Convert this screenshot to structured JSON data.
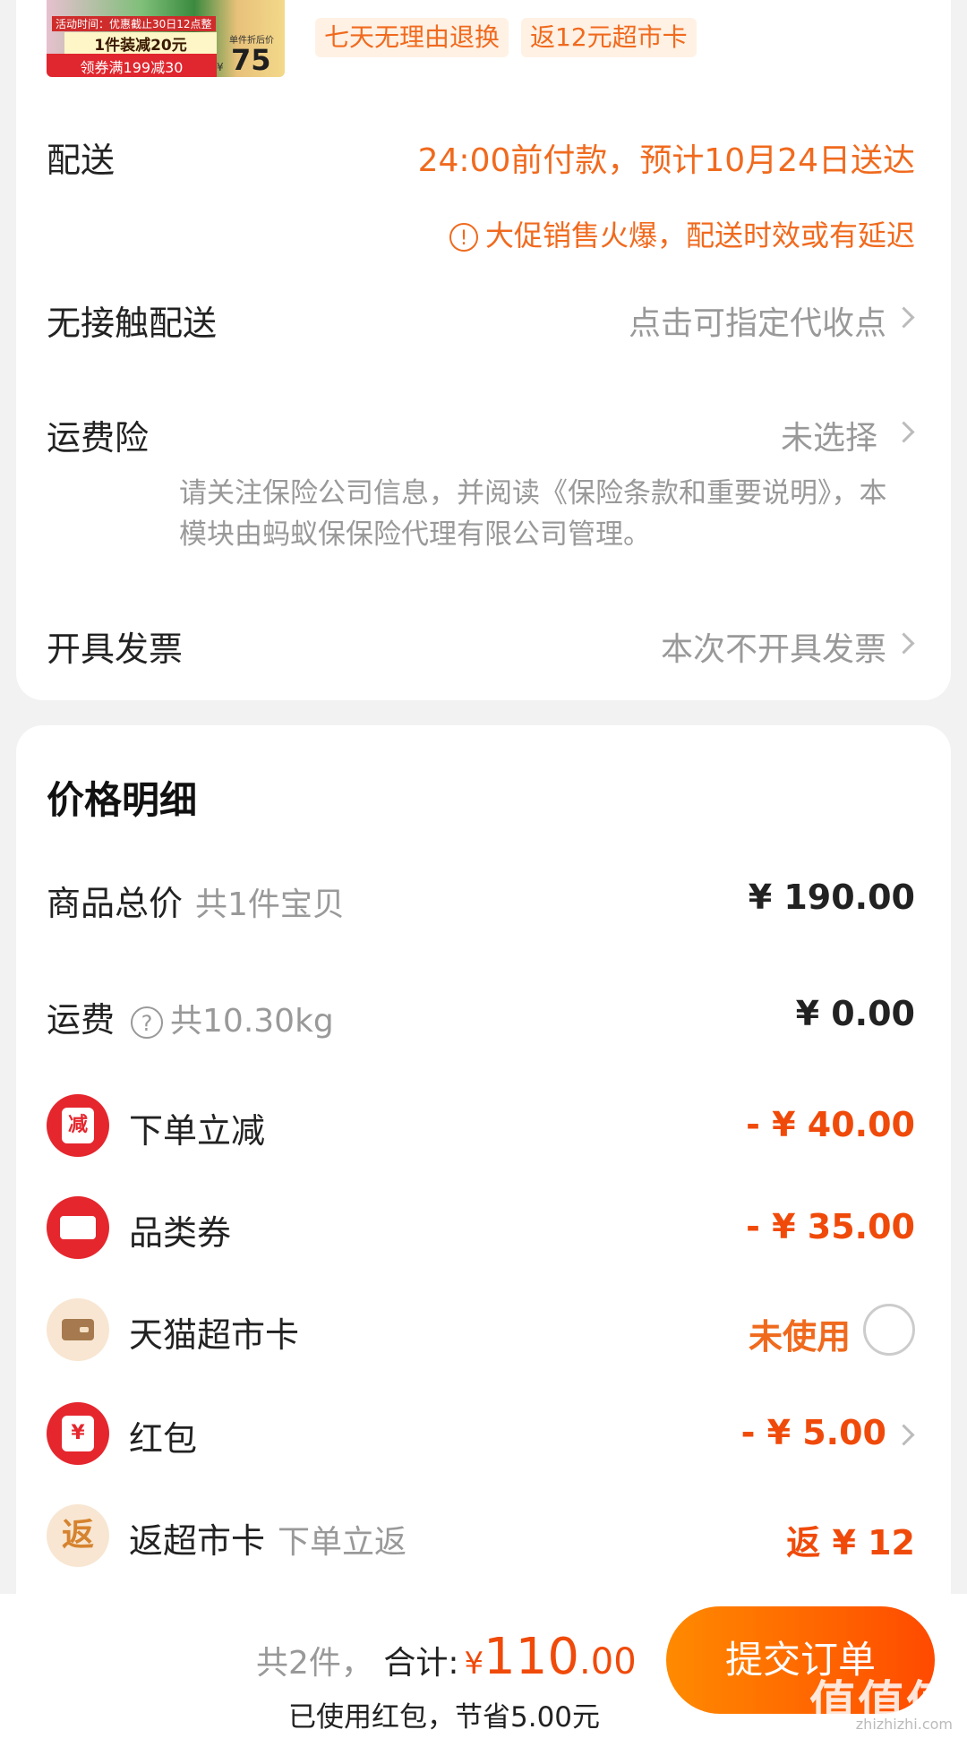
{
  "product": {
    "thumb_promo_time": "活动时间：优惠截止30日12点整",
    "thumb_discount": "1件装减20元",
    "thumb_coupon": "领券满199减30",
    "thumb_unit_label": "单件折后价",
    "thumb_price": "75",
    "thumb_yen": "¥",
    "tags": [
      "七天无理由退换",
      "返12元超市卡"
    ]
  },
  "delivery": {
    "label": "配送",
    "value": "24:00前付款，预计10月24日送达",
    "warning": "大促销售火爆，配送时效或有延迟",
    "warning_icon": "!"
  },
  "contactless": {
    "label": "无接触配送",
    "value": "点击可指定代收点"
  },
  "insurance": {
    "label": "运费险",
    "value": "未选择",
    "note": "请关注保险公司信息，并阅读《保险条款和重要说明》，本模块由蚂蚁保保险代理有限公司管理。"
  },
  "invoice": {
    "label": "开具发票",
    "value": "本次不开具发票"
  },
  "price_detail": {
    "title": "价格明细",
    "goods_total": {
      "label": "商品总价",
      "sub": "共1件宝贝",
      "value": "¥ 190.00"
    },
    "shipping": {
      "label": "运费",
      "help_icon": "?",
      "sub": "共10.30kg",
      "value": "¥ 0.00"
    },
    "order_discount": {
      "label": "下单立减",
      "icon_text": "减",
      "value": "- ¥ 40.00"
    },
    "category_coupon": {
      "label": "品类券",
      "value": "- ¥ 35.00"
    },
    "tmall_card": {
      "label": "天猫超市卡",
      "value": "未使用"
    },
    "red_packet": {
      "label": "红包",
      "icon_text": "¥",
      "value": "- ¥ 5.00"
    },
    "rebate": {
      "label": "返超市卡",
      "icon_text": "返",
      "sub": "下单立返",
      "value": "返 ¥ 12"
    }
  },
  "footer": {
    "count": "共2件，",
    "total_label": "合计:",
    "yen": "¥",
    "total_int": "110",
    "total_dec": ".00",
    "saved": "已使用红包，节省5.00元",
    "submit": "提交订单",
    "watermark": "值值值",
    "watermark_url": "zhizhizhi.com"
  },
  "colors": {
    "accent": "#f06a1e",
    "price_red": "#f04a0a",
    "icon_red": "#e5262d"
  }
}
